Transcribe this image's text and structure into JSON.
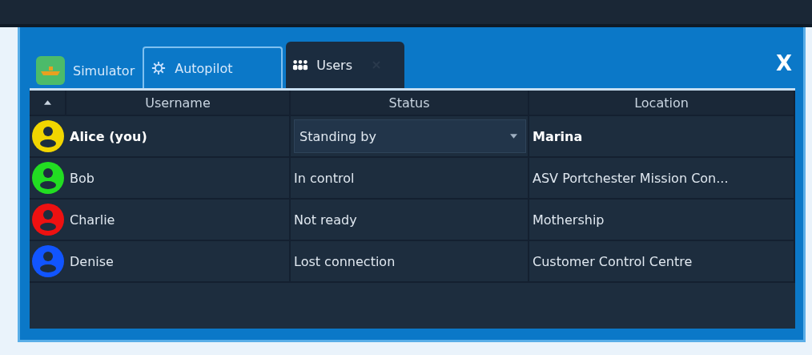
{
  "close_button": {
    "label": "X"
  },
  "tabs": [
    {
      "label": "Simulator",
      "selected": false,
      "framed": false,
      "closable": false
    },
    {
      "label": "Autopilot",
      "selected": false,
      "framed": true,
      "closable": false
    },
    {
      "label": "Users",
      "selected": true,
      "framed": false,
      "closable": true
    }
  ],
  "table": {
    "columns": [
      "Username",
      "Status",
      "Location"
    ],
    "rows": [
      {
        "color": "#f2d600",
        "username": "Alice (you)",
        "current": true,
        "status": "Standing by",
        "kind": "dropdown",
        "location": "Marina"
      },
      {
        "color": "#22dd22",
        "username": "Bob",
        "current": false,
        "status": "In control",
        "kind": "text",
        "location": "ASV Portchester Mission Con..."
      },
      {
        "color": "#ee1111",
        "username": "Charlie",
        "current": false,
        "status": "Not ready",
        "kind": "text",
        "location": "Mothership"
      },
      {
        "color": "#1155ff",
        "username": "Denise",
        "current": false,
        "status": "Lost connection",
        "kind": "text",
        "location": "Customer Control Centre"
      }
    ]
  }
}
